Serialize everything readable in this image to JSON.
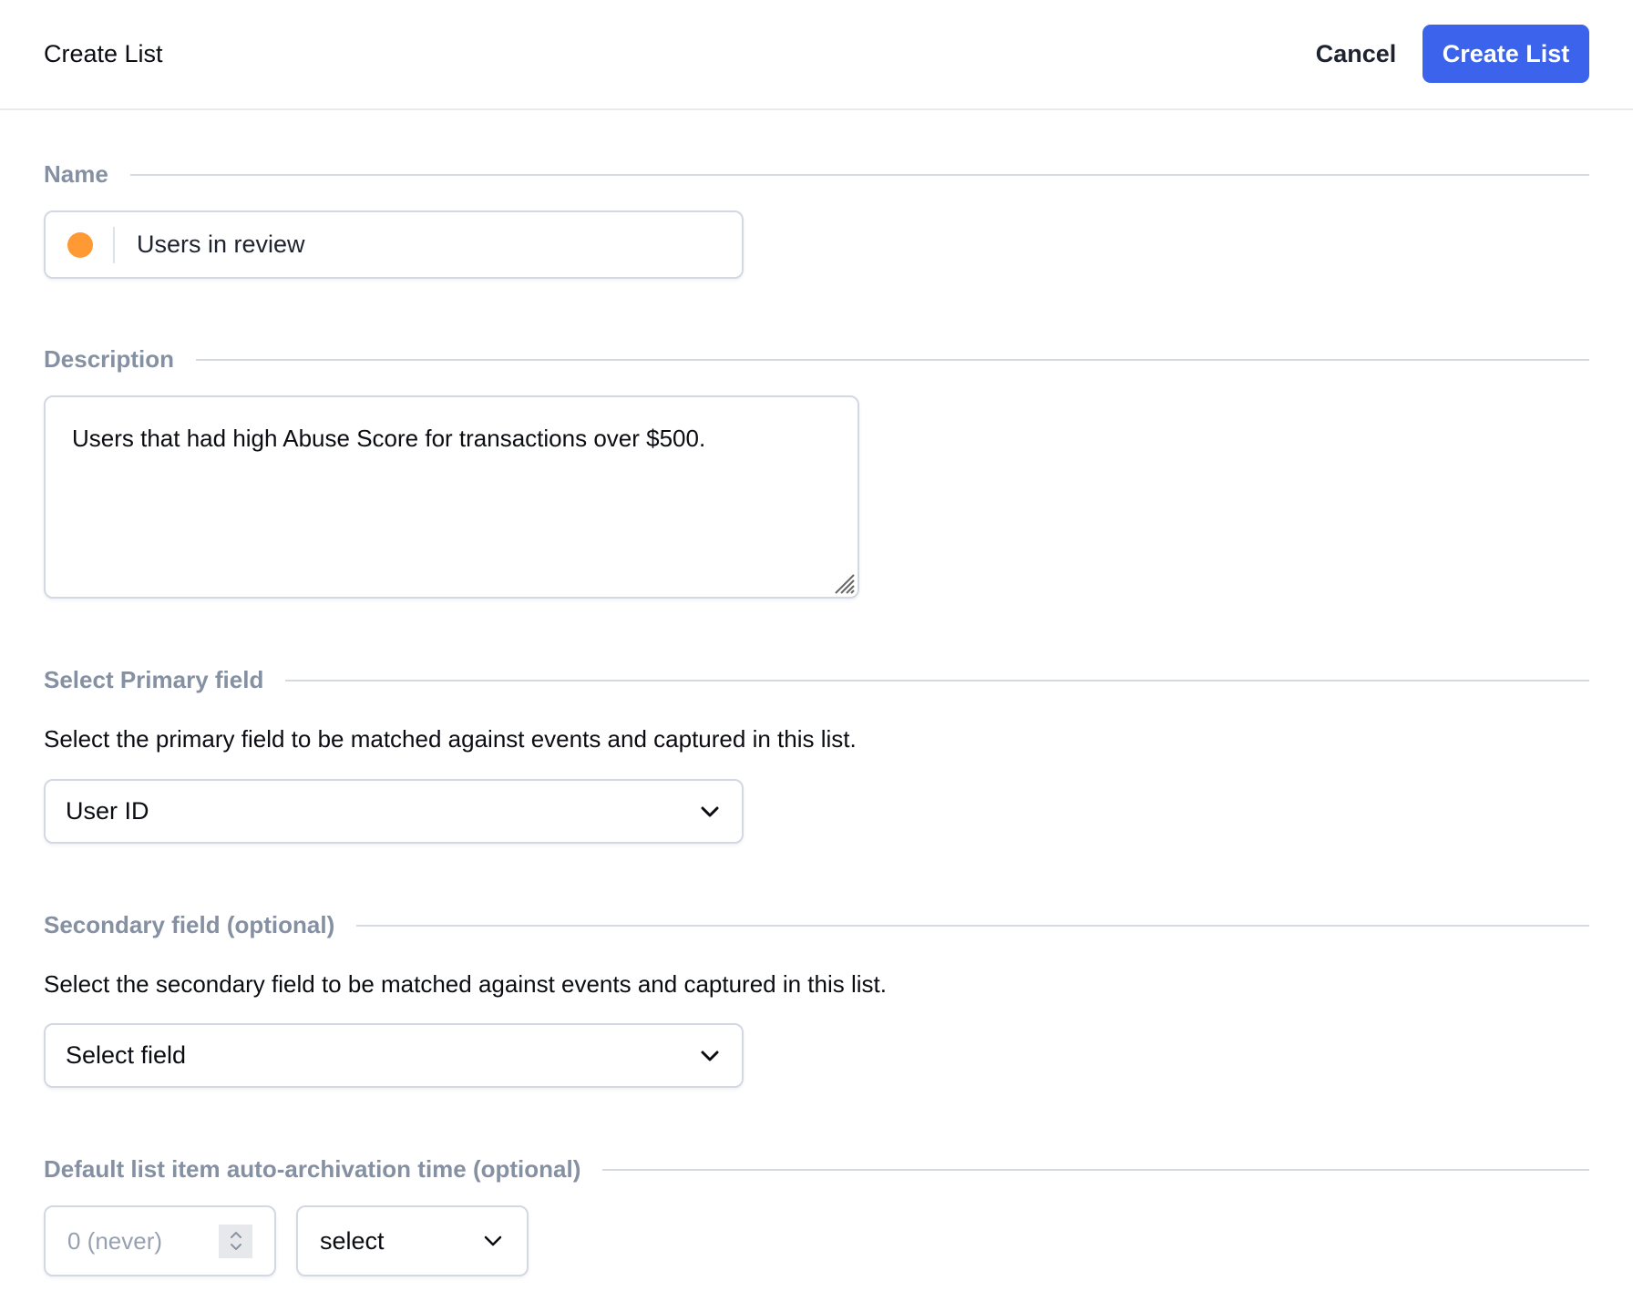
{
  "header": {
    "title": "Create List",
    "cancel_label": "Cancel",
    "create_label": "Create List",
    "accent_color": "#3b63eb"
  },
  "name_section": {
    "label": "Name",
    "color_dot": "#ff9933",
    "value": "Users in review"
  },
  "description_section": {
    "label": "Description",
    "value": "Users that had high Abuse Score for transactions over $500."
  },
  "primary_section": {
    "label": "Select Primary field",
    "helper": "Select the primary field to be matched against events and captured in this list.",
    "selected": "User ID"
  },
  "secondary_section": {
    "label": "Secondary field (optional)",
    "helper": "Select the secondary field to be matched against events and captured in this list.",
    "selected": "Select field"
  },
  "archive_section": {
    "label": "Default list item auto-archivation time (optional)",
    "number_placeholder": "0 (never)",
    "unit_selected": "select"
  }
}
